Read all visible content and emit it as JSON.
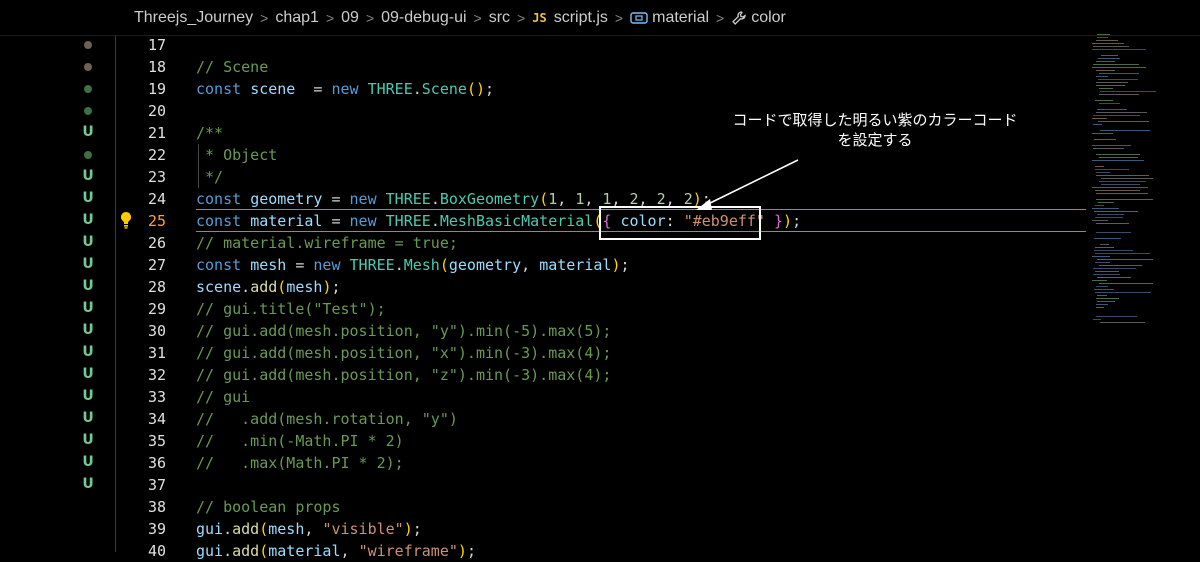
{
  "breadcrumb": {
    "items": [
      "Threejs_Journey",
      "chap1",
      "09",
      "09-debug-ui",
      "src"
    ],
    "file_badge": "JS",
    "file_name": "script.js",
    "symbol1": "material",
    "symbol2": "color",
    "separator": ">"
  },
  "editor": {
    "current_line": "25",
    "line_numbers": [
      "17",
      "18",
      "19",
      "20",
      "21",
      "22",
      "23",
      "24",
      "25",
      "26",
      "27",
      "28",
      "29",
      "30",
      "31",
      "32",
      "33",
      "34",
      "35",
      "36",
      "37",
      "38",
      "39",
      "40"
    ],
    "gutter_marks": [
      {
        "type": "dot",
        "color": "#6e6257"
      },
      {
        "type": "dot",
        "color": "#6e6257"
      },
      {
        "type": "dot",
        "color": "#3e6f46"
      },
      {
        "type": "dot",
        "color": "#3e6f46"
      },
      {
        "type": "text",
        "text": "U"
      },
      {
        "type": "dot",
        "color": "#3e6f46"
      },
      {
        "type": "text",
        "text": "U"
      },
      {
        "type": "text",
        "text": "U"
      },
      {
        "type": "text",
        "text": "U"
      },
      {
        "type": "text",
        "text": "U"
      },
      {
        "type": "text",
        "text": "U"
      },
      {
        "type": "text",
        "text": "U"
      },
      {
        "type": "text",
        "text": "U"
      },
      {
        "type": "text",
        "text": "U"
      },
      {
        "type": "text",
        "text": "U"
      },
      {
        "type": "text",
        "text": "U"
      },
      {
        "type": "text",
        "text": "U"
      },
      {
        "type": "text",
        "text": "U"
      },
      {
        "type": "text",
        "text": "U"
      },
      {
        "type": "text",
        "text": "U"
      },
      {
        "type": "text",
        "text": "U"
      }
    ],
    "lines": [
      [],
      [
        [
          "cm",
          "// Scene"
        ]
      ],
      [
        [
          "kw",
          "const "
        ],
        [
          "var",
          "scene"
        ],
        [
          "",
          "  = "
        ],
        [
          "kw",
          "new "
        ],
        [
          "cls",
          "THREE"
        ],
        [
          "",
          "."
        ],
        [
          "cls",
          "Scene"
        ],
        [
          "p1",
          "()"
        ],
        [
          "",
          ";"
        ]
      ],
      [],
      [
        [
          "cm",
          "/**"
        ]
      ],
      [
        [
          "cm",
          " * Object"
        ]
      ],
      [
        [
          "cm",
          " */"
        ]
      ],
      [
        [
          "kw",
          "const "
        ],
        [
          "var",
          "geometry"
        ],
        [
          "",
          " = "
        ],
        [
          "kw",
          "new "
        ],
        [
          "cls",
          "THREE"
        ],
        [
          "",
          "."
        ],
        [
          "cls",
          "BoxGeometry"
        ],
        [
          "p1",
          "("
        ],
        [
          "num",
          "1"
        ],
        [
          "",
          ", "
        ],
        [
          "num",
          "1"
        ],
        [
          "",
          ", "
        ],
        [
          "num",
          "1"
        ],
        [
          "",
          ", "
        ],
        [
          "num",
          "2"
        ],
        [
          "",
          ", "
        ],
        [
          "num",
          "2"
        ],
        [
          "",
          ", "
        ],
        [
          "num",
          "2"
        ],
        [
          "p1",
          ")"
        ],
        [
          "",
          ";"
        ]
      ],
      [
        [
          "kw",
          "const "
        ],
        [
          "var",
          "material"
        ],
        [
          "",
          " = "
        ],
        [
          "kw",
          "new "
        ],
        [
          "cls",
          "THREE"
        ],
        [
          "",
          "."
        ],
        [
          "cls",
          "MeshBasicMaterial"
        ],
        [
          "p1",
          "("
        ],
        [
          "p2",
          "{"
        ],
        [
          "",
          " "
        ],
        [
          "var",
          "color"
        ],
        [
          "",
          ": "
        ],
        [
          "str",
          "\"#eb9eff\""
        ],
        [
          "",
          " "
        ],
        [
          "p2",
          "}"
        ],
        [
          "p1",
          ")"
        ],
        [
          "",
          ";"
        ]
      ],
      [
        [
          "cm",
          "// material.wireframe = true;"
        ]
      ],
      [
        [
          "kw",
          "const "
        ],
        [
          "var",
          "mesh"
        ],
        [
          "",
          " = "
        ],
        [
          "kw",
          "new "
        ],
        [
          "cls",
          "THREE"
        ],
        [
          "",
          "."
        ],
        [
          "cls",
          "Mesh"
        ],
        [
          "p1",
          "("
        ],
        [
          "var",
          "geometry"
        ],
        [
          "",
          ", "
        ],
        [
          "var",
          "material"
        ],
        [
          "p1",
          ")"
        ],
        [
          "",
          ";"
        ]
      ],
      [
        [
          "var",
          "scene"
        ],
        [
          "",
          "."
        ],
        [
          "fn",
          "add"
        ],
        [
          "p1",
          "("
        ],
        [
          "var",
          "mesh"
        ],
        [
          "p1",
          ")"
        ],
        [
          "",
          ";"
        ]
      ],
      [
        [
          "cm",
          "// gui.title(\"Test\");"
        ]
      ],
      [
        [
          "cm",
          "// gui.add(mesh.position, \"y\").min(-5).max(5);"
        ]
      ],
      [
        [
          "cm",
          "// gui.add(mesh.position, \"x\").min(-3).max(4);"
        ]
      ],
      [
        [
          "cm",
          "// gui.add(mesh.position, \"z\").min(-3).max(4);"
        ]
      ],
      [
        [
          "cm",
          "// gui"
        ]
      ],
      [
        [
          "cm",
          "//   .add(mesh.rotation, \"y\")"
        ]
      ],
      [
        [
          "cm",
          "//   .min(-Math.PI * 2)"
        ]
      ],
      [
        [
          "cm",
          "//   .max(Math.PI * 2);"
        ]
      ],
      [],
      [
        [
          "cm",
          "// boolean props"
        ]
      ],
      [
        [
          "var",
          "gui"
        ],
        [
          "",
          "."
        ],
        [
          "fn",
          "add"
        ],
        [
          "p1",
          "("
        ],
        [
          "var",
          "mesh"
        ],
        [
          "",
          ", "
        ],
        [
          "str",
          "\"visible\""
        ],
        [
          "p1",
          ")"
        ],
        [
          "",
          ";"
        ]
      ],
      [
        [
          "var",
          "gui"
        ],
        [
          "",
          "."
        ],
        [
          "fn",
          "add"
        ],
        [
          "p1",
          "("
        ],
        [
          "var",
          "material"
        ],
        [
          "",
          ", "
        ],
        [
          "str",
          "\"wireframe\""
        ],
        [
          "p1",
          ")"
        ],
        [
          "",
          ";"
        ]
      ]
    ]
  },
  "annotation": {
    "line1": "コードで取得した明るい紫のカラーコード",
    "line2": "を設定する"
  },
  "colors": {
    "background": "#000000",
    "current_line_border": "#d9742d",
    "git_untracked": "#73c991",
    "highlight_box": "#ffffff"
  }
}
